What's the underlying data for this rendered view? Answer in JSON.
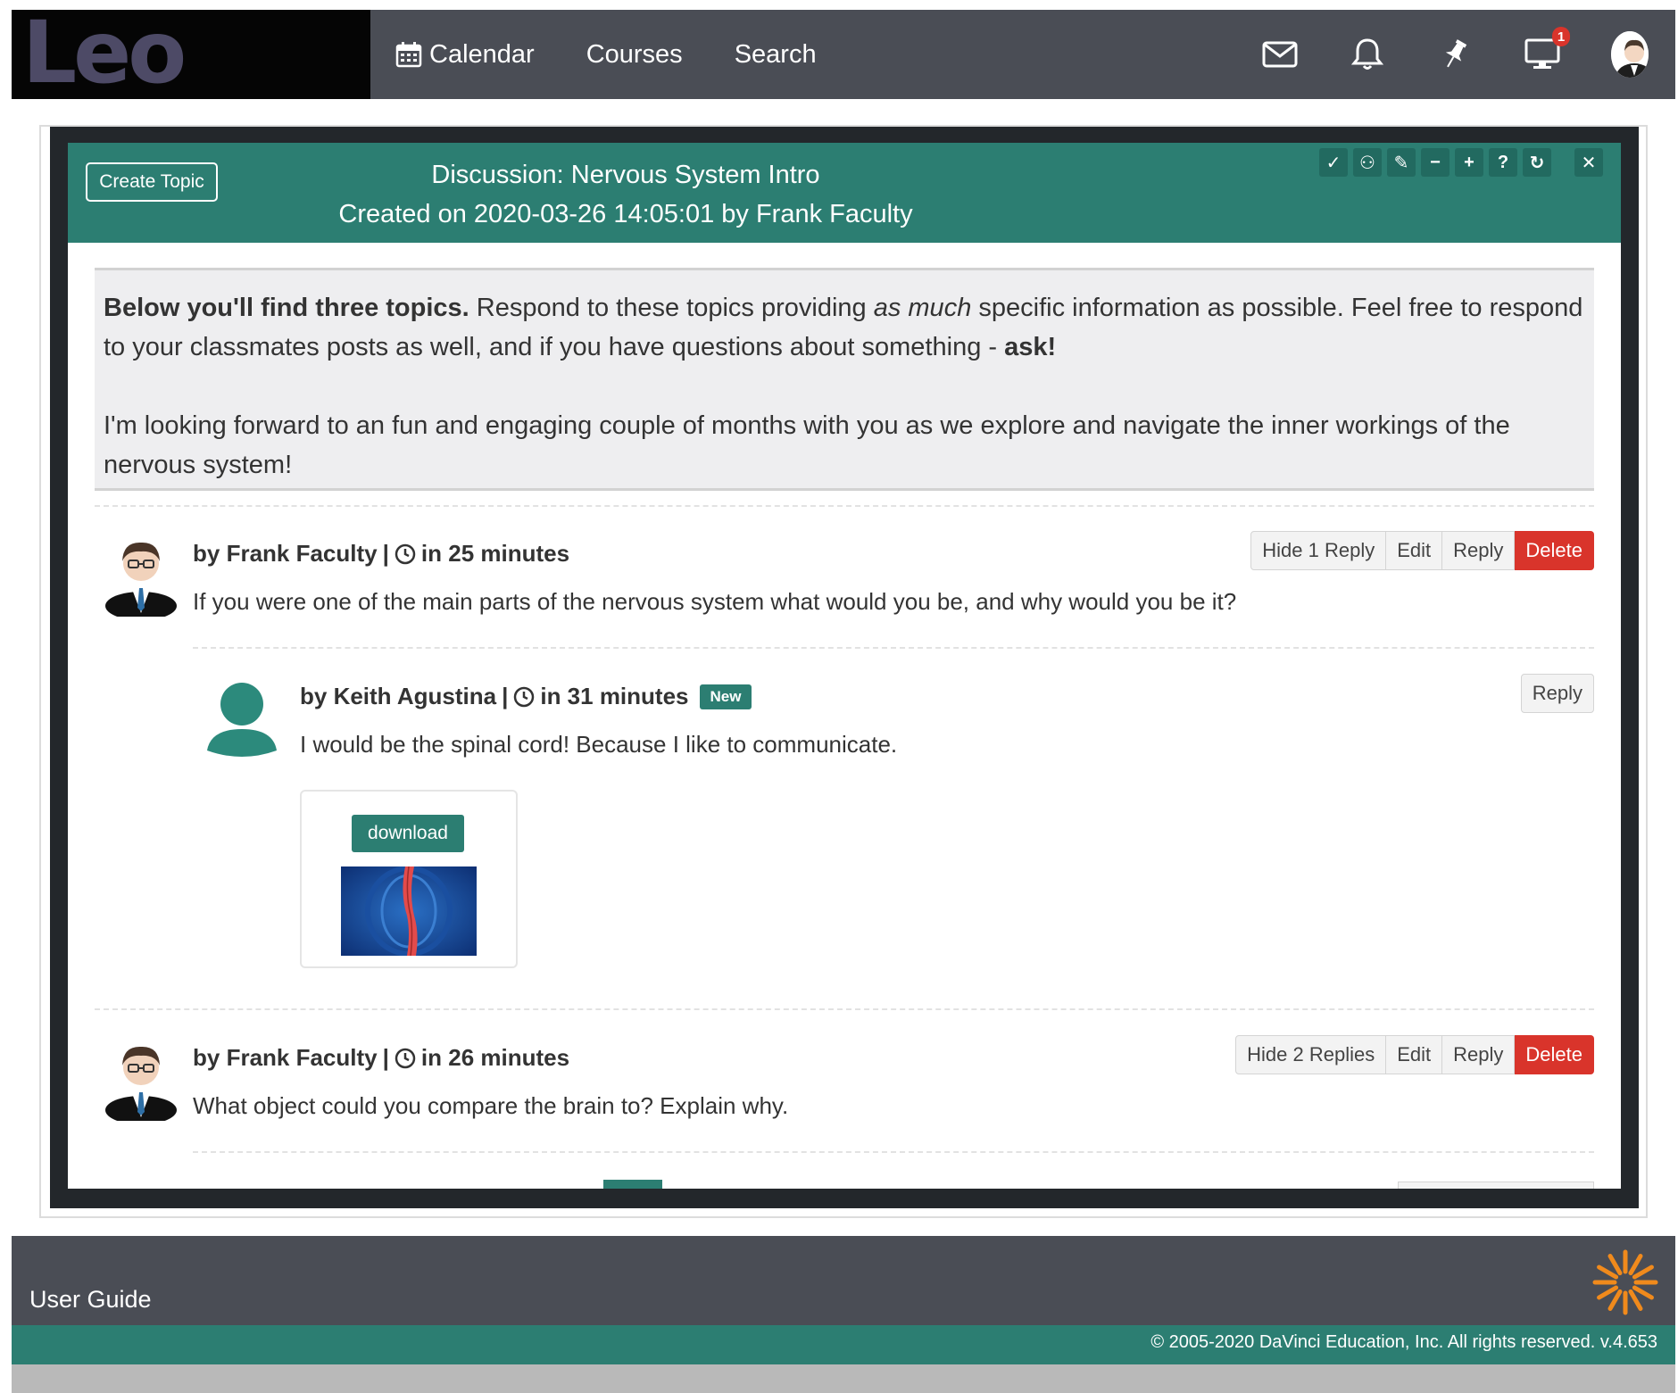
{
  "brand": {
    "logo_text": "Leo"
  },
  "nav": {
    "links": [
      {
        "label": "Calendar",
        "icon": "calendar-icon"
      },
      {
        "label": "Courses"
      },
      {
        "label": "Search"
      }
    ],
    "icons": [
      "mail-icon",
      "bell-icon",
      "pin-icon",
      "monitor-icon",
      "user-avatar"
    ],
    "monitor_badge": "1"
  },
  "discussion": {
    "create_topic_label": "Create Topic",
    "title": "Discussion: Nervous System Intro",
    "subtitle": "Created on 2020-03-26 14:05:01 by Frank Faculty",
    "tools": [
      "check-icon",
      "users-icon",
      "pencil-icon",
      "minus-icon",
      "plus-icon",
      "help-icon",
      "refresh-icon",
      "close-icon"
    ],
    "tool_glyphs": [
      "✓",
      "⚇",
      "✎",
      "−",
      "+",
      "?",
      "↻",
      "✕"
    ],
    "intro": {
      "p1_bold": "Below you'll find three topics.",
      "p1_mid": " Respond to these topics providing ",
      "p1_italic": "as much",
      "p1_end": " specific information as possible. Feel free to respond to your classmates posts as well, and if you have questions about something - ",
      "p1_ask": "ask!",
      "p2": "I'm looking forward to an fun and engaging couple of months with you as we explore and navigate the inner workings of the nervous system!"
    }
  },
  "posts": [
    {
      "author": "by Frank Faculty",
      "separator": "|",
      "time": "in 25 minutes",
      "text": "If you were one of the main parts of the nervous system what would you be, and why would you be it?",
      "buttons": {
        "hide": "Hide 1 Reply",
        "edit": "Edit",
        "reply": "Reply",
        "delete": "Delete"
      }
    },
    {
      "author": "by Keith Agustina",
      "separator": "|",
      "time": "in 31 minutes",
      "badge": "New",
      "text": "I would be the spinal cord! Because I like to communicate.",
      "buttons": {
        "reply": "Reply"
      },
      "attachment": {
        "download_label": "download"
      }
    },
    {
      "author": "by Frank Faculty",
      "separator": "|",
      "time": "in 26 minutes",
      "text": "What object could you compare the brain to? Explain why.",
      "buttons": {
        "hide": "Hide 2 Replies",
        "edit": "Edit",
        "reply": "Reply",
        "delete": "Delete"
      }
    }
  ],
  "footer": {
    "user_guide": "User Guide",
    "copyright": "© 2005-2020 DaVinci Education, Inc. All rights reserved. v.4.653"
  },
  "colors": {
    "nav_bg": "#4a4d55",
    "teal": "#2c7e72",
    "danger": "#d9342b",
    "footer_orange": "#f08a1c"
  }
}
